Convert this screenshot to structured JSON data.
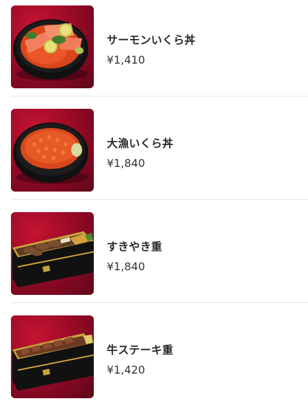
{
  "menu": {
    "items": [
      {
        "name": "サーモンいくら丼",
        "price": "¥1,410",
        "image_icon": "salmon-ikura-bowl-photo"
      },
      {
        "name": "大漁いくら丼",
        "price": "¥1,840",
        "image_icon": "ikura-bowl-photo"
      },
      {
        "name": "すきやき重",
        "price": "¥1,840",
        "image_icon": "sukiyaki-box-photo"
      },
      {
        "name": "牛ステーキ重",
        "price": "¥1,420",
        "image_icon": "beef-steak-box-photo"
      }
    ]
  }
}
